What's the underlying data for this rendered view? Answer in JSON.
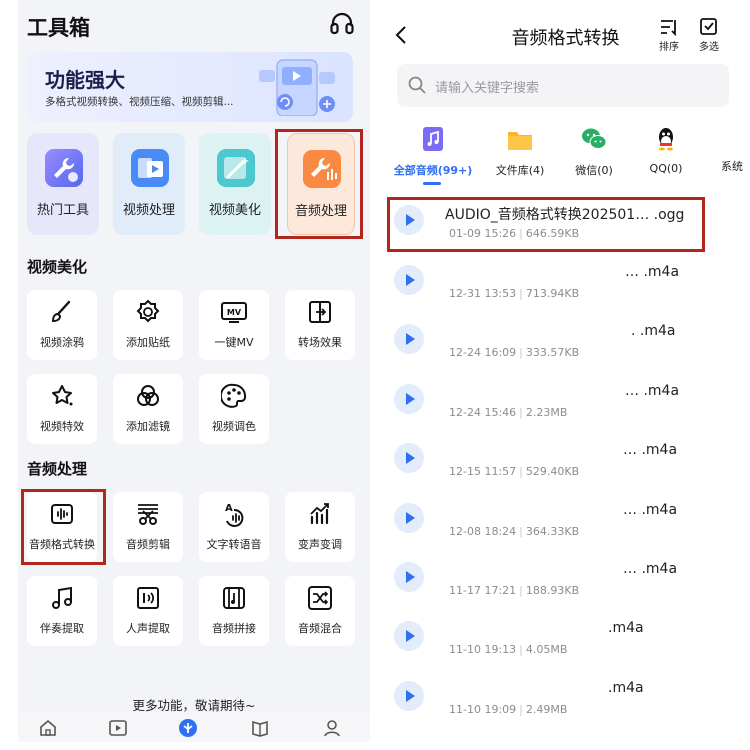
{
  "left": {
    "app_title": "工具箱",
    "banner": {
      "title": "功能强大",
      "subtitle": "多格式视频转换、视频压缩、视频剪辑..."
    },
    "tool_tiles": [
      {
        "label": "热门工具",
        "icon": "wrench-icon"
      },
      {
        "label": "视频处理",
        "icon": "video-icon"
      },
      {
        "label": "视频美化",
        "icon": "magic-wand-icon"
      },
      {
        "label": "音频处理",
        "icon": "audio-wrench-icon"
      }
    ],
    "section_video_beautify": {
      "title": "视频美化",
      "items": [
        {
          "label": "视频涂鸦",
          "icon": "brush-icon"
        },
        {
          "label": "添加贴纸",
          "icon": "sticker-icon"
        },
        {
          "label": "一键MV",
          "icon": "mv-icon"
        },
        {
          "label": "转场效果",
          "icon": "transition-icon"
        },
        {
          "label": "视频特效",
          "icon": "star-effect-icon"
        },
        {
          "label": "添加滤镜",
          "icon": "filter-icon"
        },
        {
          "label": "视频调色",
          "icon": "palette-icon"
        }
      ]
    },
    "section_audio": {
      "title": "音频处理",
      "items": [
        {
          "label": "音频格式转换",
          "icon": "audio-convert-icon"
        },
        {
          "label": "音频剪辑",
          "icon": "audio-cut-icon"
        },
        {
          "label": "文字转语音",
          "icon": "text-to-speech-icon"
        },
        {
          "label": "变声变调",
          "icon": "voice-change-icon"
        },
        {
          "label": "伴奏提取",
          "icon": "music-note-icon"
        },
        {
          "label": "人声提取",
          "icon": "vocal-extract-icon"
        },
        {
          "label": "音频拼接",
          "icon": "audio-join-icon"
        },
        {
          "label": "音频混合",
          "icon": "shuffle-icon"
        }
      ]
    },
    "more_text": "更多功能，敬请期待~",
    "nav_icons": [
      "home-icon",
      "play-icon",
      "toolbox-icon",
      "book-icon",
      "user-icon"
    ],
    "accent_color": "#2f6ff1",
    "highlight_color": "#b3261e"
  },
  "right": {
    "title": "音频格式转换",
    "sort_label": "排序",
    "multi_select_label": "多选",
    "search_placeholder": "请输入关键字搜索",
    "categories": [
      {
        "label": "全部音频(99+)",
        "icon": "music-file-icon",
        "active": true
      },
      {
        "label": "文件库(4)",
        "icon": "folder-icon",
        "active": false
      },
      {
        "label": "微信(0)",
        "icon": "wechat-icon",
        "active": false
      },
      {
        "label": "QQ(0)",
        "icon": "qq-icon",
        "active": false
      },
      {
        "label": "系统",
        "icon": "system-icon",
        "active": false
      }
    ],
    "files": [
      {
        "name": "AUDIO_音频格式转换202501… .ogg",
        "date": "01-09 15:26",
        "size": "646.59KB"
      },
      {
        "name": "… .m4a",
        "date": "12-31 13:53",
        "size": "713.94KB"
      },
      {
        "name": ". .m4a",
        "date": "12-24 16:09",
        "size": "333.57KB"
      },
      {
        "name": "… .m4a",
        "date": "12-24 15:46",
        "size": "2.23MB"
      },
      {
        "name": "… .m4a",
        "date": "12-15 11:57",
        "size": "529.40KB"
      },
      {
        "name": "… .m4a",
        "date": "12-08 18:24",
        "size": "364.33KB"
      },
      {
        "name": "… .m4a",
        "date": "11-17 17:21",
        "size": "188.93KB"
      },
      {
        "name": ".m4a",
        "date": "11-10 19:13",
        "size": "4.05MB"
      },
      {
        "name": ".m4a",
        "date": "11-10 19:09",
        "size": "2.49MB"
      }
    ]
  }
}
